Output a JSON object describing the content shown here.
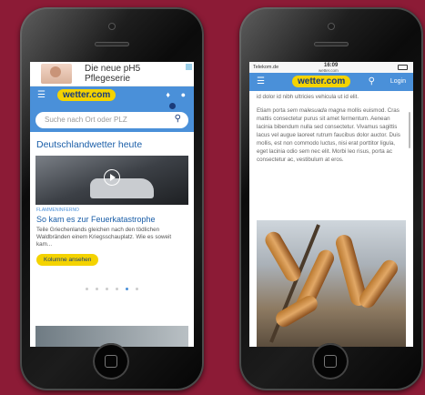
{
  "left_screen": {
    "ad": {
      "text_line1": "Die neue pH5",
      "text_line2": "Pflegeserie"
    },
    "header": {
      "logo": "wetter.com"
    },
    "search": {
      "placeholder": "Suche nach Ort oder PLZ"
    },
    "section_title": "Deutschlandwetter heute",
    "article": {
      "kicker": "FLAMMENINFERNO",
      "headline": "So kam es zur Feuerkatastrophe",
      "teaser": "Teile Griechenlands gleichen nach den tödlichen Waldbränden einem Kriegsschauplatz. Wie es soweit kam...",
      "button": "Kolumne ansehen"
    },
    "carousel": {
      "count": 6,
      "active": 5
    }
  },
  "right_screen": {
    "status": {
      "carrier": "Telekom.de",
      "time": "16:09",
      "url": "wetter.com"
    },
    "header": {
      "logo": "wetter.com",
      "login": "Login"
    },
    "article": {
      "line0": "id dolor id nibh ultricies vehicula ut id elit.",
      "p1_pre": "Etiam porta ",
      "p1_italic": "sem malesuada magna",
      "p1_post": " mollis euismod. Cras mattis consectetur purus sit amet fermentum. Aenean lacinia bibendum nulla sed consectetur. Vivamus sagittis lacus vel augue laoreet rutrum faucibus dolor auctor. Duis mollis, est non commodo luctus, nisi erat porttitor ligula, eget lacinia odio sem nec elit. Morbi leo risus, porta ac consectetur ac, vestibulum at eros."
    }
  },
  "colors": {
    "background": "#8c1b36",
    "nav_blue": "#4a90d9",
    "logo_yellow": "#f4d300",
    "title_blue": "#1a5ea8"
  }
}
